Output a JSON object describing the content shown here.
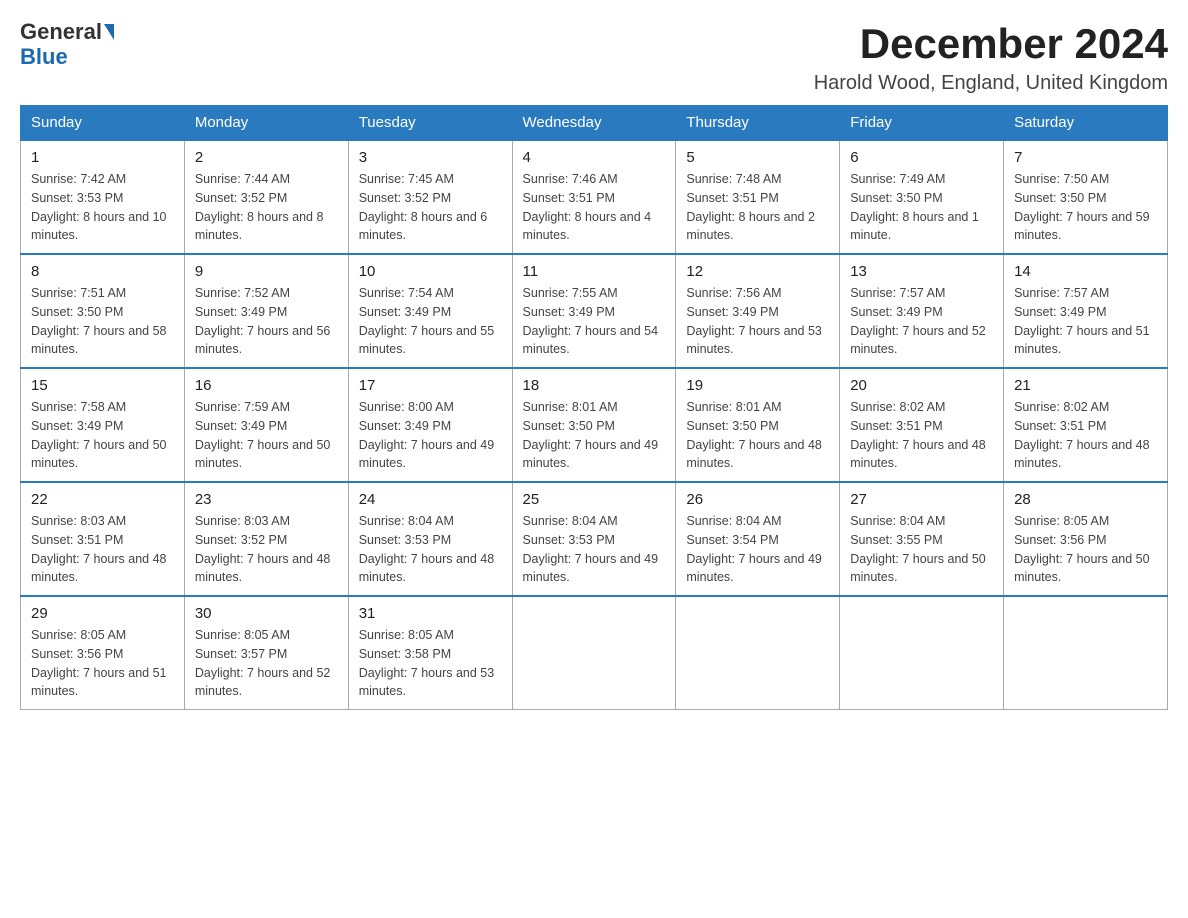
{
  "logo": {
    "general": "General",
    "blue": "Blue",
    "triangle": "▶"
  },
  "title": "December 2024",
  "subtitle": "Harold Wood, England, United Kingdom",
  "days_of_week": [
    "Sunday",
    "Monday",
    "Tuesday",
    "Wednesday",
    "Thursday",
    "Friday",
    "Saturday"
  ],
  "weeks": [
    [
      {
        "day": "1",
        "sunrise": "7:42 AM",
        "sunset": "3:53 PM",
        "daylight": "8 hours and 10 minutes."
      },
      {
        "day": "2",
        "sunrise": "7:44 AM",
        "sunset": "3:52 PM",
        "daylight": "8 hours and 8 minutes."
      },
      {
        "day": "3",
        "sunrise": "7:45 AM",
        "sunset": "3:52 PM",
        "daylight": "8 hours and 6 minutes."
      },
      {
        "day": "4",
        "sunrise": "7:46 AM",
        "sunset": "3:51 PM",
        "daylight": "8 hours and 4 minutes."
      },
      {
        "day": "5",
        "sunrise": "7:48 AM",
        "sunset": "3:51 PM",
        "daylight": "8 hours and 2 minutes."
      },
      {
        "day": "6",
        "sunrise": "7:49 AM",
        "sunset": "3:50 PM",
        "daylight": "8 hours and 1 minute."
      },
      {
        "day": "7",
        "sunrise": "7:50 AM",
        "sunset": "3:50 PM",
        "daylight": "7 hours and 59 minutes."
      }
    ],
    [
      {
        "day": "8",
        "sunrise": "7:51 AM",
        "sunset": "3:50 PM",
        "daylight": "7 hours and 58 minutes."
      },
      {
        "day": "9",
        "sunrise": "7:52 AM",
        "sunset": "3:49 PM",
        "daylight": "7 hours and 56 minutes."
      },
      {
        "day": "10",
        "sunrise": "7:54 AM",
        "sunset": "3:49 PM",
        "daylight": "7 hours and 55 minutes."
      },
      {
        "day": "11",
        "sunrise": "7:55 AM",
        "sunset": "3:49 PM",
        "daylight": "7 hours and 54 minutes."
      },
      {
        "day": "12",
        "sunrise": "7:56 AM",
        "sunset": "3:49 PM",
        "daylight": "7 hours and 53 minutes."
      },
      {
        "day": "13",
        "sunrise": "7:57 AM",
        "sunset": "3:49 PM",
        "daylight": "7 hours and 52 minutes."
      },
      {
        "day": "14",
        "sunrise": "7:57 AM",
        "sunset": "3:49 PM",
        "daylight": "7 hours and 51 minutes."
      }
    ],
    [
      {
        "day": "15",
        "sunrise": "7:58 AM",
        "sunset": "3:49 PM",
        "daylight": "7 hours and 50 minutes."
      },
      {
        "day": "16",
        "sunrise": "7:59 AM",
        "sunset": "3:49 PM",
        "daylight": "7 hours and 50 minutes."
      },
      {
        "day": "17",
        "sunrise": "8:00 AM",
        "sunset": "3:49 PM",
        "daylight": "7 hours and 49 minutes."
      },
      {
        "day": "18",
        "sunrise": "8:01 AM",
        "sunset": "3:50 PM",
        "daylight": "7 hours and 49 minutes."
      },
      {
        "day": "19",
        "sunrise": "8:01 AM",
        "sunset": "3:50 PM",
        "daylight": "7 hours and 48 minutes."
      },
      {
        "day": "20",
        "sunrise": "8:02 AM",
        "sunset": "3:51 PM",
        "daylight": "7 hours and 48 minutes."
      },
      {
        "day": "21",
        "sunrise": "8:02 AM",
        "sunset": "3:51 PM",
        "daylight": "7 hours and 48 minutes."
      }
    ],
    [
      {
        "day": "22",
        "sunrise": "8:03 AM",
        "sunset": "3:51 PM",
        "daylight": "7 hours and 48 minutes."
      },
      {
        "day": "23",
        "sunrise": "8:03 AM",
        "sunset": "3:52 PM",
        "daylight": "7 hours and 48 minutes."
      },
      {
        "day": "24",
        "sunrise": "8:04 AM",
        "sunset": "3:53 PM",
        "daylight": "7 hours and 48 minutes."
      },
      {
        "day": "25",
        "sunrise": "8:04 AM",
        "sunset": "3:53 PM",
        "daylight": "7 hours and 49 minutes."
      },
      {
        "day": "26",
        "sunrise": "8:04 AM",
        "sunset": "3:54 PM",
        "daylight": "7 hours and 49 minutes."
      },
      {
        "day": "27",
        "sunrise": "8:04 AM",
        "sunset": "3:55 PM",
        "daylight": "7 hours and 50 minutes."
      },
      {
        "day": "28",
        "sunrise": "8:05 AM",
        "sunset": "3:56 PM",
        "daylight": "7 hours and 50 minutes."
      }
    ],
    [
      {
        "day": "29",
        "sunrise": "8:05 AM",
        "sunset": "3:56 PM",
        "daylight": "7 hours and 51 minutes."
      },
      {
        "day": "30",
        "sunrise": "8:05 AM",
        "sunset": "3:57 PM",
        "daylight": "7 hours and 52 minutes."
      },
      {
        "day": "31",
        "sunrise": "8:05 AM",
        "sunset": "3:58 PM",
        "daylight": "7 hours and 53 minutes."
      },
      null,
      null,
      null,
      null
    ]
  ]
}
